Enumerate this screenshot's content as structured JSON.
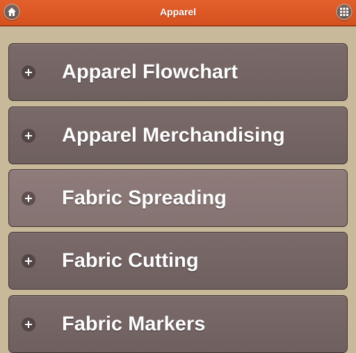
{
  "header": {
    "title": "Apparel",
    "home_icon": "home-icon",
    "menu_icon": "grid-icon"
  },
  "colors": {
    "header_bg": "#d95a25",
    "page_bg": "#c8b99b",
    "item_bg": "#756564",
    "item_active_bg": "#8a7877",
    "text": "#ffffff"
  },
  "list": {
    "items": [
      {
        "label": "Apparel Flowchart",
        "icon": "plus-icon",
        "active": false
      },
      {
        "label": "Apparel Merchandising",
        "icon": "plus-icon",
        "active": false
      },
      {
        "label": "Fabric Spreading",
        "icon": "plus-icon",
        "active": true
      },
      {
        "label": "Fabric Cutting",
        "icon": "plus-icon",
        "active": false
      },
      {
        "label": "Fabric Markers",
        "icon": "plus-icon",
        "active": false
      }
    ]
  }
}
